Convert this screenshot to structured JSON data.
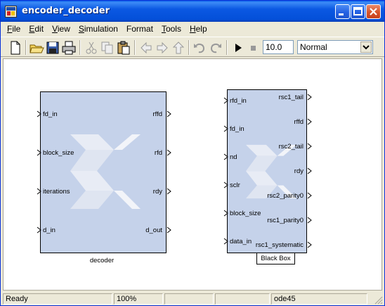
{
  "window": {
    "title": "encoder_decoder",
    "accent": "#0450d9"
  },
  "menu": [
    {
      "label": "File",
      "key": "F",
      "rest": "ile"
    },
    {
      "label": "Edit",
      "key": "E",
      "rest": "dit"
    },
    {
      "label": "View",
      "key": "V",
      "rest": "iew"
    },
    {
      "label": "Simulation",
      "key": "S",
      "rest": "imulation"
    },
    {
      "label": "Format",
      "key": "",
      "rest": "Format"
    },
    {
      "label": "Tools",
      "key": "T",
      "rest": "ools"
    },
    {
      "label": "Help",
      "key": "H",
      "rest": "elp"
    }
  ],
  "toolbar": {
    "icons": [
      "new-model-icon",
      "open-icon",
      "save-icon",
      "print-icon",
      "cut-icon",
      "copy-icon",
      "paste-icon",
      "back-icon",
      "forward-icon",
      "up-icon",
      "undo-icon",
      "redo-icon",
      "run-icon",
      "stop-icon"
    ],
    "stop_time": "10.0",
    "sim_mode": "Normal"
  },
  "blocks": {
    "decoder": {
      "caption": "decoder",
      "inputs": [
        "fd_in",
        "block_size",
        "iterations",
        "d_in"
      ],
      "outputs": [
        "rffd",
        "rfd",
        "rdy",
        "d_out"
      ]
    },
    "blackbox": {
      "caption": "Black Box",
      "inputs": [
        "rfd_in",
        "fd_in",
        "nd",
        "sclr",
        "block_size",
        "data_in"
      ],
      "outputs": [
        "rsc1_tail",
        "rffd",
        "rsc2_tail",
        "rdy",
        "rsc2_parity0",
        "rsc1_parity0",
        "rsc1_systematic"
      ]
    }
  },
  "status": {
    "state": "Ready",
    "zoom": "100%",
    "empty1": "",
    "empty2": "",
    "solver": "ode45"
  }
}
